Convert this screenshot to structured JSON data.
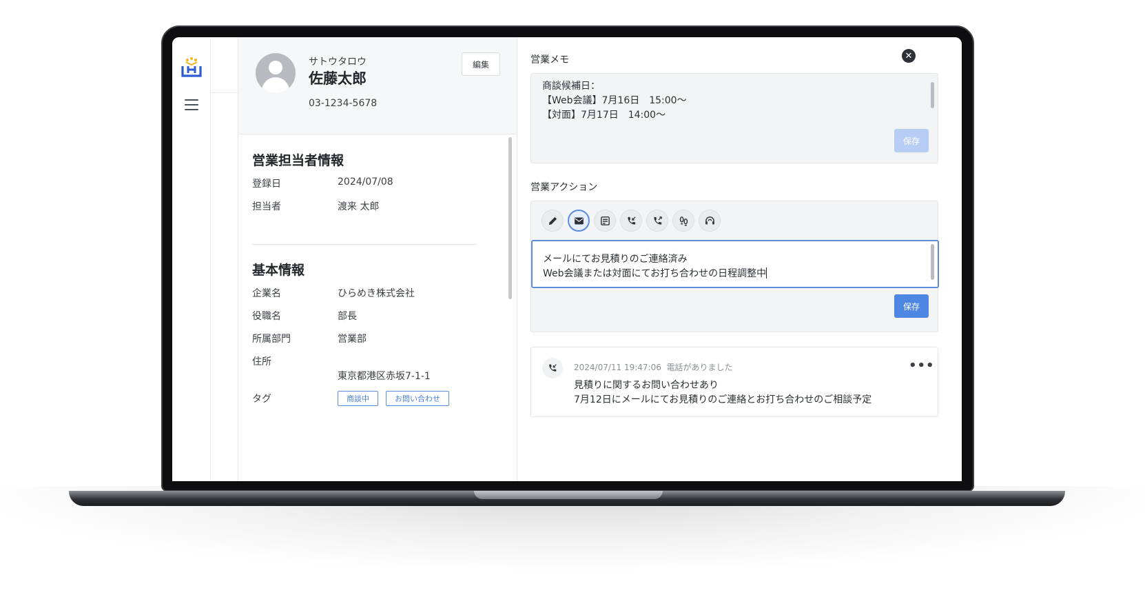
{
  "profile": {
    "kana": "サトウタロウ",
    "name": "佐藤太郎",
    "phone": "03-1234-5678",
    "edit_label": "編集"
  },
  "sales_rep": {
    "title": "営業担当者情報",
    "rows": [
      {
        "label": "登録日",
        "value": "2024/07/08"
      },
      {
        "label": "担当者",
        "value": "渡来 太郎"
      }
    ]
  },
  "basic_info": {
    "title": "基本情報",
    "rows": [
      {
        "label": "企業名",
        "value": "ひらめき株式会社"
      },
      {
        "label": "役職名",
        "value": "部長"
      },
      {
        "label": "所属部門",
        "value": "営業部"
      },
      {
        "label": "住所",
        "value": "東京都港区赤坂7-1-1"
      },
      {
        "label": "タグ",
        "value": ""
      }
    ],
    "tags": [
      "商談中",
      "お問い合わせ"
    ]
  },
  "memo": {
    "title": "営業メモ",
    "lines": [
      "商談候補日：",
      "【Web会議】7月16日　15:00〜",
      "【対面】7月17日　14:00〜"
    ],
    "save_label": "保存"
  },
  "action": {
    "title": "営業アクション",
    "icons": [
      "pencil-icon",
      "mail-icon",
      "note-icon",
      "phone-incoming-icon",
      "phone-outgoing-icon",
      "footsteps-icon",
      "support-headset-icon"
    ],
    "active_icon": "mail-icon",
    "text_lines": [
      "メールにてお見積りのご連絡済み",
      "Web会議または対面にてお打ち合わせの日程調整中"
    ],
    "save_label": "保存"
  },
  "history": {
    "timestamp": "2024/07/11 19:47:06",
    "event": "電話がありました",
    "lines": [
      "見積りに関するお問い合わせあり",
      "7月12日にメールにてお見積りのご連絡とお打ち合わせのご相談予定"
    ],
    "more_label": "•••"
  },
  "close_label": "✕",
  "colors": {
    "accent": "#4e86e4",
    "accent_disabled": "#b8cdf4",
    "tag": "#4a7fd6",
    "logo_blue": "#2f5bd1",
    "logo_gold": "#f2b51e"
  }
}
